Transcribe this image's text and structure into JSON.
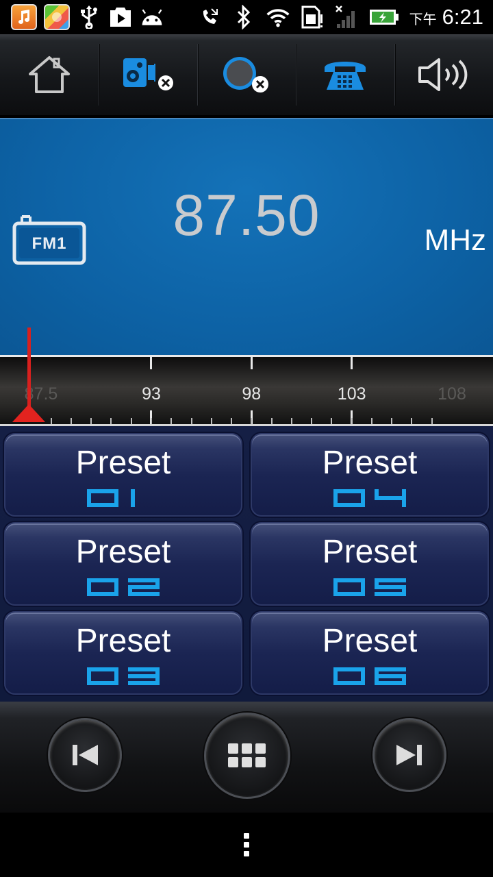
{
  "status_bar": {
    "ampm": "下午",
    "time": "6:21",
    "icons": [
      "music-app-icon",
      "app-store-icon",
      "usb-icon",
      "play-store-icon",
      "android-icon",
      "phone-missed-icon",
      "bluetooth-icon",
      "wifi-icon",
      "sim-alert-icon",
      "signal-icon",
      "battery-charging-icon"
    ]
  },
  "toolbar": {
    "buttons": [
      "home-icon",
      "speaker-disabled-icon",
      "record-disabled-icon",
      "telephone-icon",
      "volume-icon"
    ]
  },
  "display": {
    "band": "FM1",
    "frequency": "87.50",
    "unit": "MHz"
  },
  "tuner": {
    "labels": [
      "87.5",
      "93",
      "98",
      "103",
      "108"
    ],
    "current_value": 87.5,
    "range": [
      87.5,
      108
    ]
  },
  "presets": [
    {
      "label": "Preset",
      "number": "01"
    },
    {
      "label": "Preset",
      "number": "04"
    },
    {
      "label": "Preset",
      "number": "02"
    },
    {
      "label": "Preset",
      "number": "05"
    },
    {
      "label": "Preset",
      "number": "03"
    },
    {
      "label": "Preset",
      "number": "06"
    }
  ],
  "transport": {
    "buttons": [
      "previous-icon",
      "grid-menu-icon",
      "next-icon"
    ]
  },
  "accent_colors": {
    "display_blue": "#0d62a5",
    "preset_digit_blue": "#1aa3ea",
    "needle_red": "#e3231f",
    "preset_bg": "#141d48"
  }
}
